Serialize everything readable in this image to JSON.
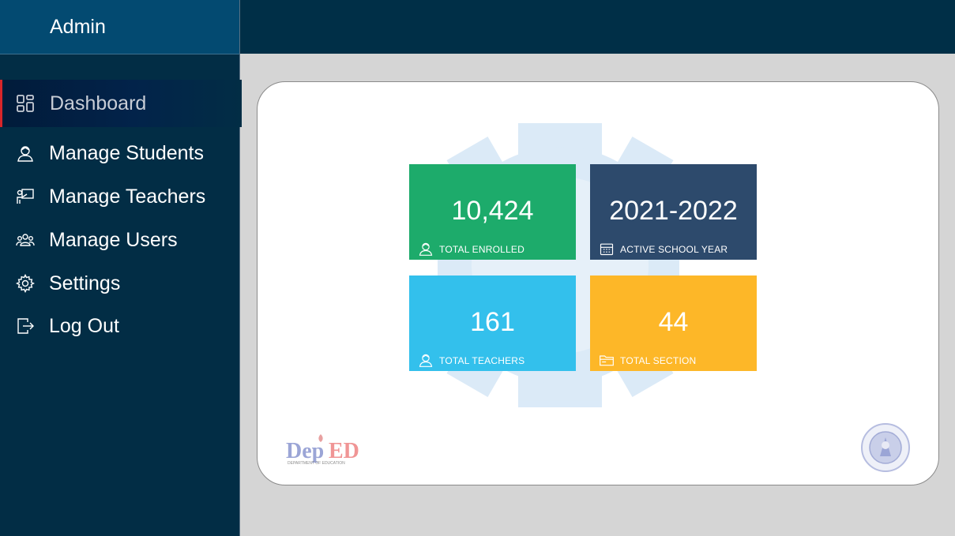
{
  "sidebar": {
    "title": "Admin",
    "items": [
      {
        "label": "Dashboard",
        "icon": "dashboard-icon",
        "active": true
      },
      {
        "label": "Manage Students",
        "icon": "student-icon"
      },
      {
        "label": "Manage Teachers",
        "icon": "teacher-icon"
      },
      {
        "label": "Manage Users",
        "icon": "users-icon"
      },
      {
        "label": "Settings",
        "icon": "gear-icon"
      },
      {
        "label": "Log Out",
        "icon": "logout-icon"
      }
    ]
  },
  "stats": [
    {
      "value": "10,424",
      "caption": "TOTAL ENROLLED",
      "icon": "student-icon",
      "color": "#1dab6b"
    },
    {
      "value": "2021-2022",
      "caption": "ACTIVE SCHOOL YEAR",
      "icon": "calendar-icon",
      "color": "#2d4a6c"
    },
    {
      "value": "161",
      "caption": "TOTAL TEACHERS",
      "icon": "teacher-icon",
      "color": "#33c0ec"
    },
    {
      "value": "44",
      "caption": "TOTAL SECTION",
      "icon": "folder-icon",
      "color": "#fdb728"
    }
  ],
  "logos": {
    "deped_text": "DepED",
    "deped_sub": "DEPARTMENT OF EDUCATION",
    "seal": "seal-logo"
  },
  "colors": {
    "sidebar_bg": "#022d45",
    "header_bg": "#034a71",
    "topbar_bg": "#002f47",
    "active_marker": "#d8252a",
    "content_bg": "#d5d5d5"
  }
}
